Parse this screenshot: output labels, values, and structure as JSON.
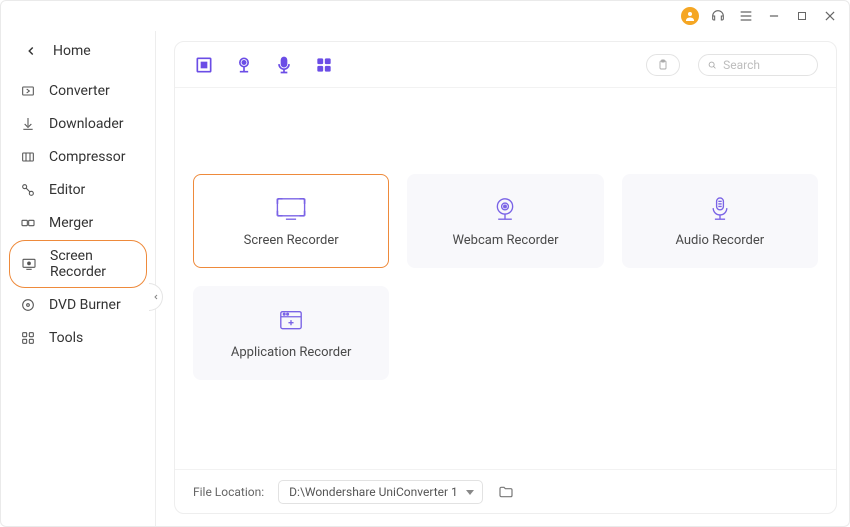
{
  "titlebar": {
    "avatar": "user-avatar",
    "support": "support-icon",
    "menu": "menu-icon"
  },
  "sidebar": {
    "home": "Home",
    "items": [
      {
        "id": "converter",
        "label": "Converter"
      },
      {
        "id": "downloader",
        "label": "Downloader"
      },
      {
        "id": "compressor",
        "label": "Compressor"
      },
      {
        "id": "editor",
        "label": "Editor"
      },
      {
        "id": "merger",
        "label": "Merger"
      },
      {
        "id": "screen-recorder",
        "label": "Screen Recorder",
        "active": true
      },
      {
        "id": "dvd-burner",
        "label": "DVD Burner"
      },
      {
        "id": "tools",
        "label": "Tools"
      }
    ]
  },
  "toolbar": {
    "modes": [
      "screen",
      "webcam",
      "audio",
      "apps"
    ],
    "search_placeholder": "Search"
  },
  "cards": [
    {
      "id": "screen-recorder-card",
      "label": "Screen Recorder",
      "selected": true
    },
    {
      "id": "webcam-recorder-card",
      "label": "Webcam Recorder"
    },
    {
      "id": "audio-recorder-card",
      "label": "Audio Recorder"
    },
    {
      "id": "application-recorder-card",
      "label": "Application Recorder"
    }
  ],
  "footer": {
    "file_location_label": "File Location:",
    "path": "D:\\Wondershare UniConverter 1"
  }
}
